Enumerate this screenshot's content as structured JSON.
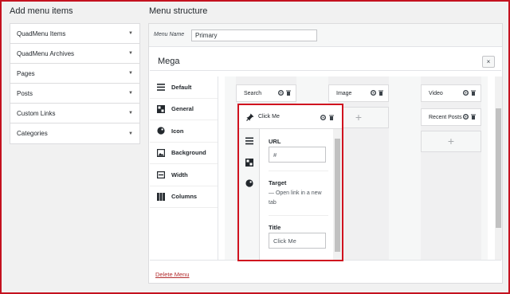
{
  "left_panel": {
    "title": "Add menu items",
    "items": [
      {
        "label": "QuadMenu Items"
      },
      {
        "label": "QuadMenu Archives"
      },
      {
        "label": "Pages"
      },
      {
        "label": "Posts"
      },
      {
        "label": "Custom Links"
      },
      {
        "label": "Categories"
      }
    ],
    "caret_icon": "caret-down-icon"
  },
  "menu_structure": {
    "title": "Menu structure",
    "menu_name_label": "Menu Name",
    "menu_name_value": "Primary",
    "item_title": "Mega",
    "close_label": "×",
    "delete_label": "Delete Menu"
  },
  "tabs": [
    {
      "label": "Default",
      "icon": "menu-lines-icon"
    },
    {
      "label": "General",
      "icon": "general-grid-icon"
    },
    {
      "label": "Icon",
      "icon": "palette-icon"
    },
    {
      "label": "Background",
      "icon": "image-icon"
    },
    {
      "label": "Width",
      "icon": "width-icon"
    },
    {
      "label": "Columns",
      "icon": "columns-icon"
    }
  ],
  "columns": [
    {
      "items": [
        "Search"
      ]
    },
    {
      "items": [
        "Image"
      ]
    },
    {
      "items": [
        "Video",
        "Recent Posts"
      ]
    }
  ],
  "popup": {
    "title": "Click Me",
    "url_label": "URL",
    "url_value": "#",
    "target_label": "Target",
    "target_value": "— Open link in a new tab",
    "title_label": "Title",
    "title_value": "Click Me"
  },
  "colors": {
    "frame": "#c4121f",
    "delete_link": "#b32d2e"
  }
}
